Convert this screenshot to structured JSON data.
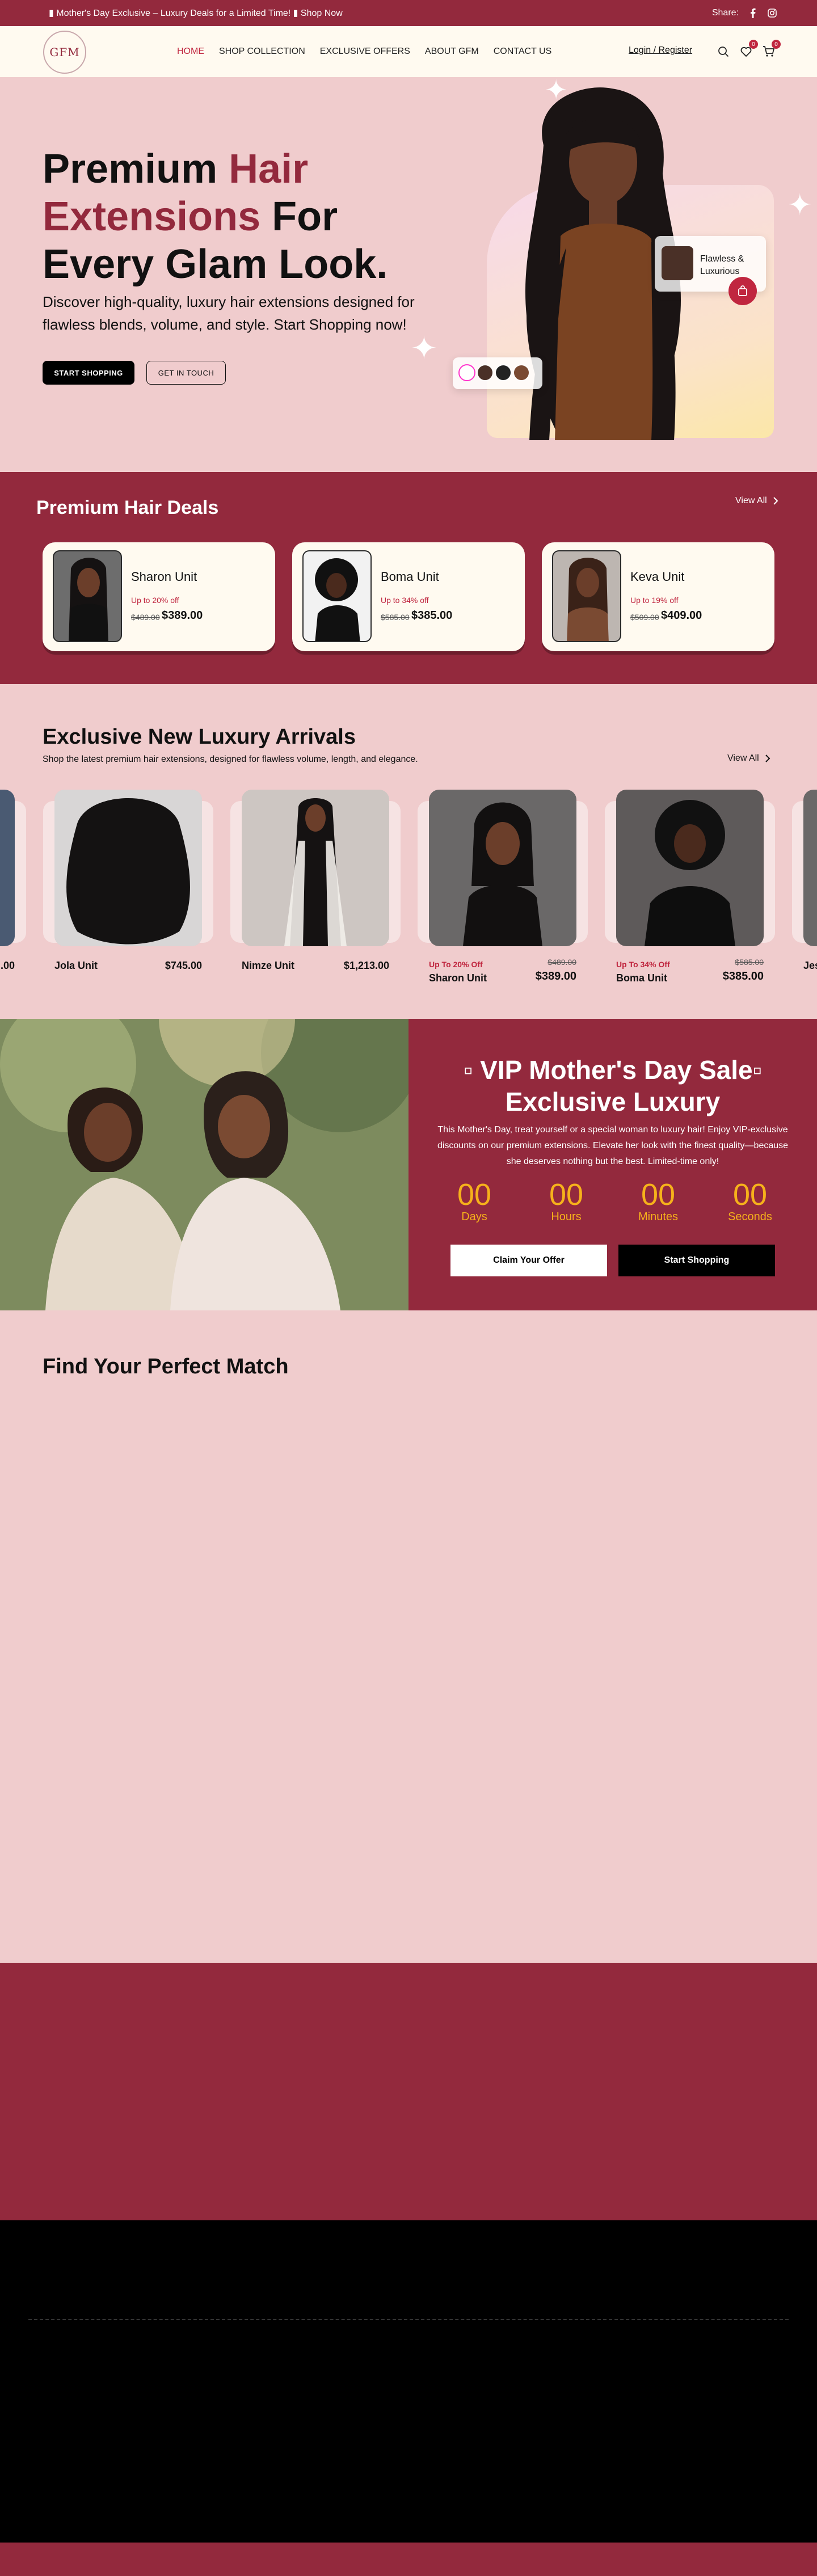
{
  "topbar": {
    "announcement": "▮ Mother's Day Exclusive – Luxury Deals for a Limited Time! ▮ Shop Now",
    "share_label": "Share:",
    "social_icons": [
      "facebook-icon",
      "instagram-icon"
    ]
  },
  "nav": {
    "logo_text": "GFM",
    "items": [
      {
        "label": "HOME",
        "active": true
      },
      {
        "label": "SHOP COLLECTION",
        "active": false
      },
      {
        "label": "EXCLUSIVE OFFERS",
        "active": false
      },
      {
        "label": "ABOUT GFM",
        "active": false
      },
      {
        "label": "CONTACT US",
        "active": false
      }
    ],
    "login_label": "Login / Register",
    "wishlist_count": "0",
    "cart_count": "0"
  },
  "hero": {
    "title_part1": "Premium ",
    "title_accent1": "Hair",
    "title_accent2": "Extensions",
    "title_part2": " For",
    "title_line3": "Every Glam Look.",
    "subtitle": "Discover high-quality, luxury hair extensions designed for flawless blends, volume, and style. Start Shopping now!",
    "primary_button": "START SHOPPING",
    "secondary_button": "GET IN TOUCH",
    "card_text_line1": "Flawless &",
    "card_text_line2": "Luxurious"
  },
  "deals": {
    "title": "Premium Hair Deals",
    "view_all": "View All",
    "items": [
      {
        "name": "Sharon Unit",
        "discount": "Up to 20% off",
        "old_price": "$489.00",
        "price": "$389.00"
      },
      {
        "name": "Boma Unit",
        "discount": "Up to 34% off",
        "old_price": "$585.00",
        "price": "$385.00"
      },
      {
        "name": "Keva Unit",
        "discount": "Up to 19% off",
        "old_price": "$509.00",
        "price": "$409.00"
      }
    ]
  },
  "arrivals": {
    "title": "Exclusive New Luxury Arrivals",
    "description": "Shop the latest premium hair extensions, designed for flawless volume, length, and elegance.",
    "view_all": "View All",
    "partial_left_price": ".00",
    "items": [
      {
        "name": "Jola Unit",
        "price": "$745.00"
      },
      {
        "name": "Nimze Unit",
        "price": "$1,213.00"
      },
      {
        "name": "Sharon Unit",
        "discount": "Up To 20% Off",
        "old_price": "$489.00",
        "price": "$389.00"
      },
      {
        "name": "Boma Unit",
        "discount": "Up To 34% Off",
        "old_price": "$585.00",
        "price": "$385.00"
      }
    ],
    "partial_right_name": "Jes"
  },
  "vip": {
    "title_line1": "▫ VIP Mother's Day Sale▫",
    "title_line2": "Exclusive Luxury",
    "paragraph": "This Mother's Day, treat yourself or a special woman to luxury hair! Enjoy VIP-exclusive discounts on our premium extensions. Elevate her look with the finest quality—because she deserves nothing but the best. Limited-time only!",
    "countdown": [
      {
        "value": "00",
        "label": "Days"
      },
      {
        "value": "00",
        "label": "Hours"
      },
      {
        "value": "00",
        "label": "Minutes"
      },
      {
        "value": "00",
        "label": "Seconds"
      }
    ],
    "claim_button": "Claim Your Offer",
    "shop_button": "Start Shopping"
  },
  "match": {
    "title": "Find Your Perfect Match"
  },
  "colors": {
    "maroon": "#93293d",
    "pink_bg": "#f0cccd",
    "accent_red": "#c0263f",
    "cream": "#fffaf0",
    "countdown_gold": "#f6b11b"
  }
}
